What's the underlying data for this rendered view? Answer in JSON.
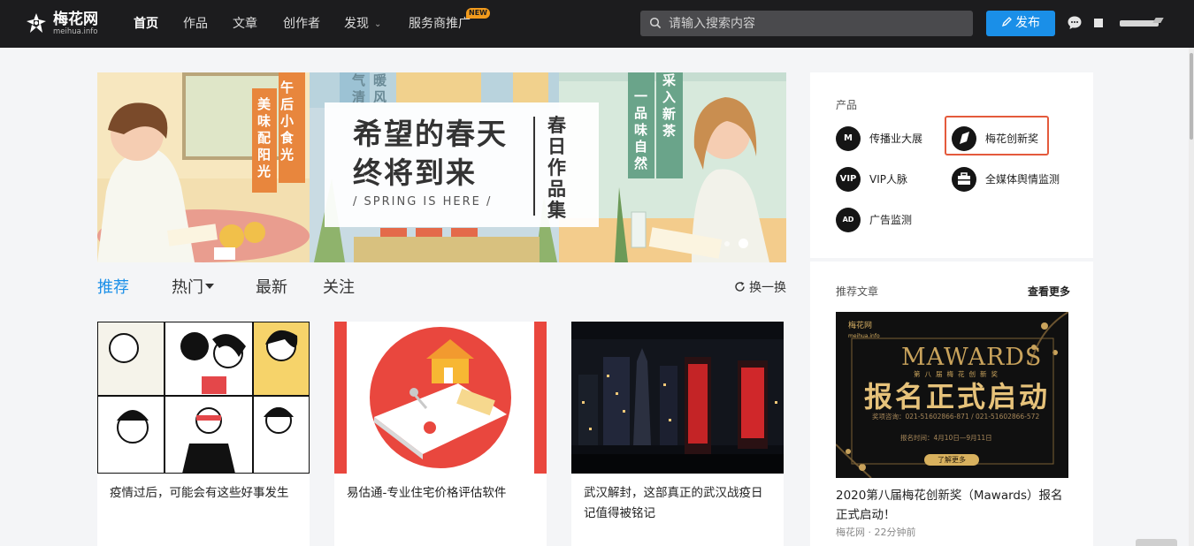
{
  "header": {
    "logo_name": "梅花网",
    "logo_sub": "meihua.info",
    "nav": [
      "首页",
      "作品",
      "文章",
      "创作者",
      "发现",
      "服务商推广"
    ],
    "new_badge": "NEW",
    "search_placeholder": "请输入搜索内容",
    "publish_label": "发布"
  },
  "banner": {
    "title_line1": "希望的春天",
    "title_line2": "终将到来",
    "subtitle": "/ SPRING IS HERE /",
    "vertical": "春日作品集",
    "left_sign_a": "午后小食光",
    "left_sign_b": "美味配阳光",
    "mid_sign_a": "暖风",
    "mid_sign_b": "气清",
    "right_sign_a": "一品味自然",
    "right_sign_b": "采入新茶"
  },
  "tabs": [
    "推荐",
    "热门",
    "最新",
    "关注"
  ],
  "refresh_label": "换一换",
  "cards": [
    {
      "title": "疫情过后，可能会有这些好事发生"
    },
    {
      "title": "易估通-专业住宅价格评估软件"
    },
    {
      "title": "武汉解封，这部真正的武汉战疫日记值得被铭记"
    }
  ],
  "sidebar": {
    "products_label": "产品",
    "products": [
      {
        "label": "传播业大展",
        "icon": "expo-icon",
        "icon_text": "M"
      },
      {
        "label": "梅花创新奖",
        "icon": "award-icon",
        "icon_text": ""
      },
      {
        "label": "VIP人脉",
        "icon": "vip-icon",
        "icon_text": "VIP"
      },
      {
        "label": "全媒体舆情监测",
        "icon": "briefcase-icon",
        "icon_text": ""
      },
      {
        "label": "广告监测",
        "icon": "ad-monitor-icon",
        "icon_text": "AD"
      }
    ],
    "recommend_label": "推荐文章",
    "more_label": "查看更多",
    "ad": {
      "brand": "梅花网",
      "brand_sub": "meihua.info",
      "mawards": "MAWARDS",
      "small": "第八届梅花创新奖",
      "main": "报名正式启动",
      "tel": "奖项咨询：021-51602866-871 / 021-51602866-572",
      "date": "报名时间：4月10日—9月11日",
      "button": "了解更多"
    },
    "article_title": "2020第八届梅花创新奖（Mawards）报名正式启动！",
    "article_meta": "梅花网 · 22分钟前"
  },
  "colors": {
    "accent": "#1a8fe8",
    "header_bg": "#1c1c1e",
    "highlight_border": "#e45a3c",
    "new_badge": "#f29b1d"
  }
}
